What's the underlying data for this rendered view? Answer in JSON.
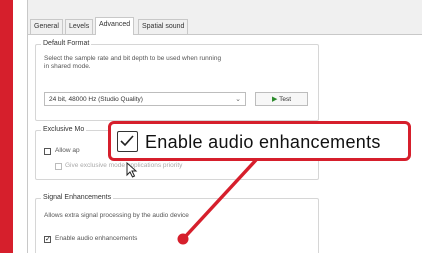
{
  "theme": {
    "accent_red": "#d61f2c",
    "dialog_bg": "#f0f0f0"
  },
  "tabs": [
    {
      "label": "General"
    },
    {
      "label": "Levels"
    },
    {
      "label": "Advanced"
    },
    {
      "label": "Spatial sound"
    }
  ],
  "default_format": {
    "title": "Default Format",
    "description_line1": "Select the sample rate and bit depth to be used when running",
    "description_line2": "in shared mode.",
    "selected_format": "24 bit, 48000 Hz (Studio Quality)",
    "test_button": "Test"
  },
  "exclusive_mode": {
    "title": "Exclusive Mo",
    "allow_label": "Allow ap",
    "priority_label": "Give exclusive mode applications priority"
  },
  "signal_enhancements": {
    "title": "Signal Enhancements",
    "description": "Allows extra signal processing by the audio device",
    "checkbox_label": "Enable audio enhancements"
  },
  "callout": {
    "label": "Enable audio enhancements"
  },
  "icons": {
    "checkbox": "checkbox-checked-icon",
    "play": "play-icon",
    "cursor": "mouse-pointer-icon"
  }
}
